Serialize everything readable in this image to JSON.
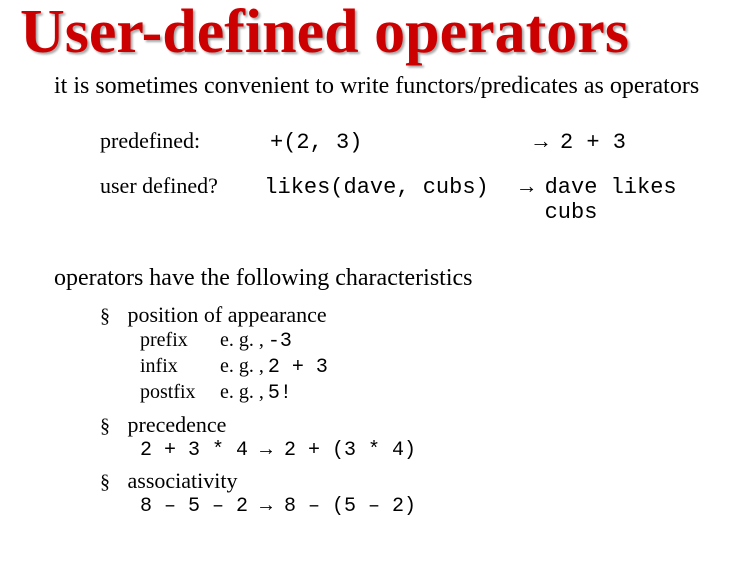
{
  "title": "User-defined operators",
  "intro": "it is sometimes convenient to write functors/predicates as operators",
  "arrow": "→",
  "examples": [
    {
      "label": "predefined:",
      "functor": "+(2, 3)",
      "op": "2 + 3"
    },
    {
      "label": "user defined?",
      "functor": "likes(dave, cubs)",
      "op": "dave likes cubs"
    }
  ],
  "section2": "operators have the following characteristics",
  "bullets": {
    "position": {
      "label": "position of appearance",
      "items": [
        {
          "name": "prefix",
          "eg": "e. g. ,",
          "code": "-3"
        },
        {
          "name": "infix",
          "eg": "e. g. ,",
          "code": "2 + 3"
        },
        {
          "name": "postfix",
          "eg": "e. g. ,",
          "code": "5!"
        }
      ]
    },
    "precedence": {
      "label": "precedence",
      "lhs": "2 + 3 * 4",
      "rhs": "2 + (3 * 4)"
    },
    "associativity": {
      "label": "associativity",
      "lhs": "8 – 5 – 2",
      "rhs": "8 – (5 – 2)"
    }
  }
}
